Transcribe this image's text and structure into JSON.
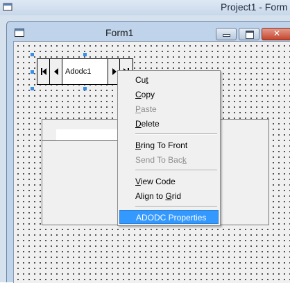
{
  "ide": {
    "window_title": "Project1 - Form"
  },
  "form": {
    "title": "Form1"
  },
  "adodc": {
    "caption": "Adodc1",
    "buttons": [
      "first",
      "previous",
      "next",
      "last"
    ]
  },
  "context_menu": {
    "items": [
      {
        "label": "Cut",
        "mnemonic": "t",
        "enabled": true
      },
      {
        "label": "Copy",
        "mnemonic": "C",
        "enabled": true
      },
      {
        "label": "Paste",
        "mnemonic": "P",
        "enabled": false
      },
      {
        "label": "Delete",
        "mnemonic": "D",
        "enabled": true
      },
      {
        "label": "Bring To Front",
        "mnemonic": "B",
        "enabled": true
      },
      {
        "label": "Send To Back",
        "mnemonic": "k",
        "enabled": false
      },
      {
        "label": "View Code",
        "mnemonic": "V",
        "enabled": true
      },
      {
        "label": "Align to Grid",
        "mnemonic": "G",
        "enabled": true
      },
      {
        "label": "ADODC Properties",
        "mnemonic": "",
        "enabled": true,
        "highlighted": true
      }
    ]
  },
  "colors": {
    "highlight": "#3399ff",
    "selection_handle": "#3b8ee6",
    "close_button": "#c4452e"
  }
}
